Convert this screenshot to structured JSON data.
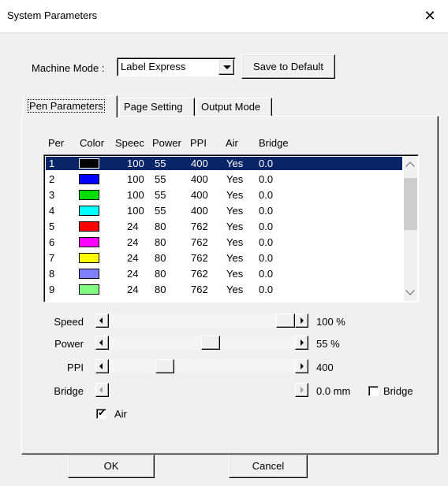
{
  "window": {
    "title": "System Parameters",
    "close_glyph": "✕"
  },
  "machine_mode": {
    "label": "Machine Mode :",
    "value": "Label Express",
    "save_button": "Save to Default"
  },
  "tabs": [
    {
      "label": "Pen Parameters",
      "active": true
    },
    {
      "label": "Page Setting",
      "active": false
    },
    {
      "label": "Output Mode",
      "active": false
    }
  ],
  "table": {
    "columns": [
      "Per",
      "Color",
      "Speec",
      "Power",
      "PPI",
      "Air",
      "Bridge"
    ],
    "rows": [
      {
        "per": "1",
        "color": "#000000",
        "speed": "100",
        "power": "55",
        "ppi": "400",
        "air": "Yes",
        "bridge": "0.0",
        "selected": true
      },
      {
        "per": "2",
        "color": "#0000ff",
        "speed": "100",
        "power": "55",
        "ppi": "400",
        "air": "Yes",
        "bridge": "0.0"
      },
      {
        "per": "3",
        "color": "#00dd00",
        "speed": "100",
        "power": "55",
        "ppi": "400",
        "air": "Yes",
        "bridge": "0.0"
      },
      {
        "per": "4",
        "color": "#00ffff",
        "speed": "100",
        "power": "55",
        "ppi": "400",
        "air": "Yes",
        "bridge": "0.0"
      },
      {
        "per": "5",
        "color": "#ff0000",
        "speed": "24",
        "power": "80",
        "ppi": "762",
        "air": "Yes",
        "bridge": "0.0"
      },
      {
        "per": "6",
        "color": "#ff00ff",
        "speed": "24",
        "power": "80",
        "ppi": "762",
        "air": "Yes",
        "bridge": "0.0"
      },
      {
        "per": "7",
        "color": "#ffff00",
        "speed": "24",
        "power": "80",
        "ppi": "762",
        "air": "Yes",
        "bridge": "0.0"
      },
      {
        "per": "8",
        "color": "#8080ff",
        "speed": "24",
        "power": "80",
        "ppi": "762",
        "air": "Yes",
        "bridge": "0.0"
      },
      {
        "per": "9",
        "color": "#80ff80",
        "speed": "24",
        "power": "80",
        "ppi": "762",
        "air": "Yes",
        "bridge": "0.0"
      }
    ]
  },
  "sliders": {
    "speed": {
      "label": "Speed",
      "value_text": "100 %",
      "fraction": 1.0
    },
    "power": {
      "label": "Power",
      "value_text": "55  %",
      "fraction": 0.55
    },
    "ppi": {
      "label": "PPI",
      "value_text": "400",
      "fraction": 0.28
    },
    "bridge": {
      "label": "Bridge",
      "value_text": "0.0 mm",
      "checkbox_label": "Bridge",
      "checked": false
    }
  },
  "air": {
    "label": "Air",
    "checked": true
  },
  "buttons": {
    "ok": "OK",
    "cancel": "Cancel"
  }
}
